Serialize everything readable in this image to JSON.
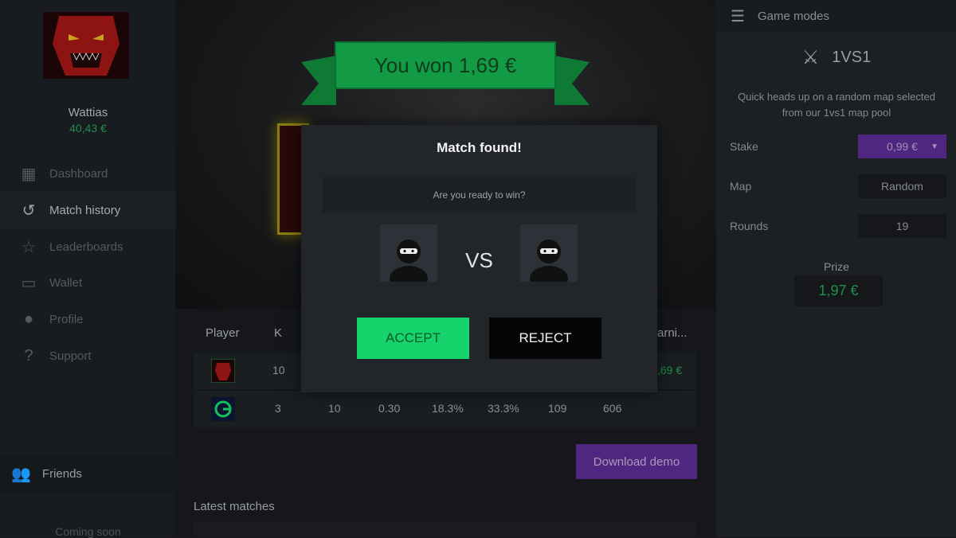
{
  "user": {
    "name": "Wattias",
    "balance": "40,43 €"
  },
  "sidebar": {
    "items": [
      {
        "label": "Dashboard",
        "icon": "grid-icon"
      },
      {
        "label": "Match history",
        "icon": "history-icon",
        "active": true
      },
      {
        "label": "Leaderboards",
        "icon": "star-icon"
      },
      {
        "label": "Wallet",
        "icon": "wallet-icon"
      },
      {
        "label": "Profile",
        "icon": "ninja-icon"
      },
      {
        "label": "Support",
        "icon": "question-bubble-icon"
      }
    ],
    "friends": "Friends",
    "coming_soon": "Coming soon"
  },
  "banner": {
    "text": "You won 1,69 €"
  },
  "scoreboard": {
    "headers": [
      "Player",
      "K",
      "arni..."
    ],
    "rows": [
      {
        "avatar": "demon",
        "k": "10",
        "earnings": ",69 €"
      },
      {
        "avatar": "g-logo",
        "k": "3",
        "cols": [
          "10",
          "0.30",
          "18.3%",
          "33.3%",
          "109",
          "606"
        ]
      }
    ]
  },
  "download_demo": "Download demo",
  "latest_matches": "Latest matches",
  "modal": {
    "title": "Match found!",
    "question": "Are you ready to win?",
    "vs": "VS",
    "accept": "ACCEPT",
    "reject": "REJECT"
  },
  "game_modes": {
    "title": "Game modes",
    "mode": "1VS1",
    "description": "Quick heads up on a random map selected from our 1vs1 map pool",
    "stake_label": "Stake",
    "stake": "0,99 €",
    "map_label": "Map",
    "map": "Random",
    "rounds_label": "Rounds",
    "rounds": "19",
    "prize_label": "Prize",
    "prize": "1,97 €"
  },
  "colors": {
    "accent_green": "#16d36b",
    "purple": "#4f2780",
    "money_green": "#1d8f4c"
  }
}
